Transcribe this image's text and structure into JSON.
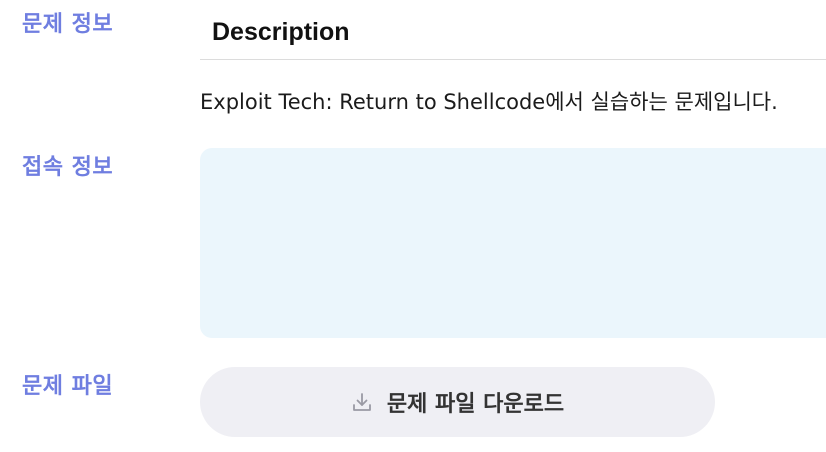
{
  "labels": {
    "problem_info": "문제 정보",
    "connection_info": "접속 정보",
    "problem_file": "문제 파일"
  },
  "description": {
    "title": "Description",
    "text": "Exploit Tech: Return to Shellcode에서 실습하는 문제입니다."
  },
  "connection": {
    "content": ""
  },
  "download": {
    "label": "문제 파일 다운로드",
    "icon": "download-icon"
  },
  "colors": {
    "label_accent": "#6f7ee0",
    "connection_box_bg": "#ebf6fc",
    "button_bg": "#efeff4"
  }
}
